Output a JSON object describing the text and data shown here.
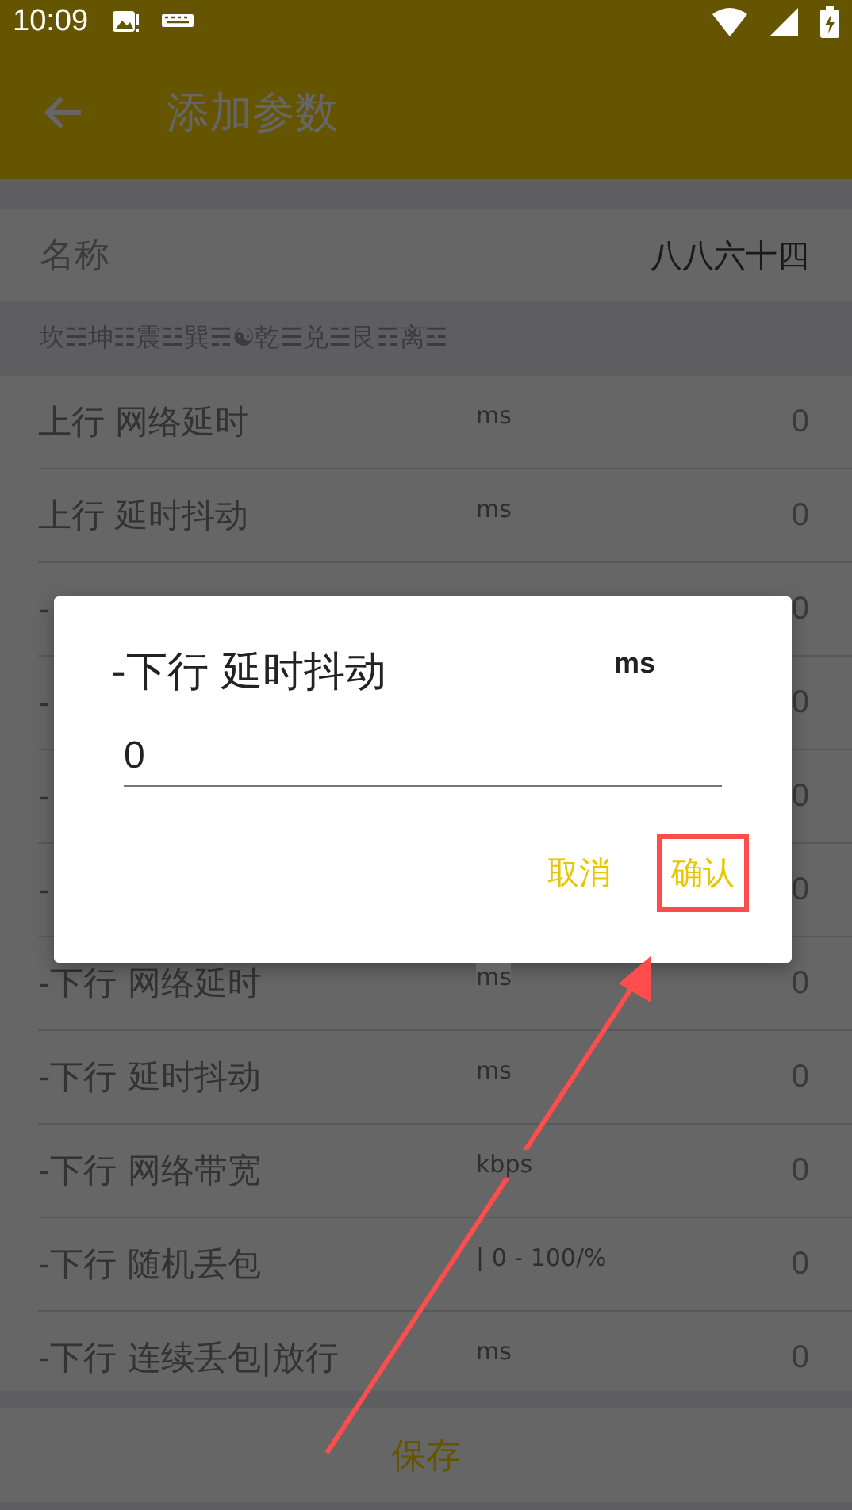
{
  "status_bar": {
    "time": "10:09"
  },
  "app_bar": {
    "title": "添加参数"
  },
  "name_field": {
    "label": "名称",
    "value": "八八六十四"
  },
  "section_header": "坎☵坤☷震☳巽☴☯乾☰兑☱艮☶离☲",
  "rows": [
    {
      "label": "上行 网络延时",
      "unit": "ms",
      "value": "0"
    },
    {
      "label": "上行 延时抖动",
      "unit": "ms",
      "value": "0"
    },
    {
      "label": "-",
      "value": "0"
    },
    {
      "label": "-",
      "value": "0"
    },
    {
      "label": "-",
      "value": "0"
    },
    {
      "label": "-",
      "value": "0"
    },
    {
      "label": "-下行 网络延时",
      "unit": "ms",
      "value": "0"
    },
    {
      "label": "-下行 延时抖动",
      "unit": "ms",
      "value": "0"
    },
    {
      "label": "-下行 网络带宽",
      "unit": "kbps",
      "value": "0"
    },
    {
      "label": "-下行 随机丢包",
      "unit": "| 0 - 100/%",
      "value": "0"
    },
    {
      "label": "-下行 连续丢包|放行",
      "unit": "ms",
      "value": "0"
    }
  ],
  "dialog": {
    "title": "-下行 延时抖动",
    "unit": "ms",
    "input_value": "0",
    "buttons": [
      {
        "label": "取消",
        "highlighted": false
      },
      {
        "label": "确认",
        "highlighted": true
      }
    ]
  },
  "save_button": "保存",
  "annotation": {
    "kind": "arrow"
  }
}
